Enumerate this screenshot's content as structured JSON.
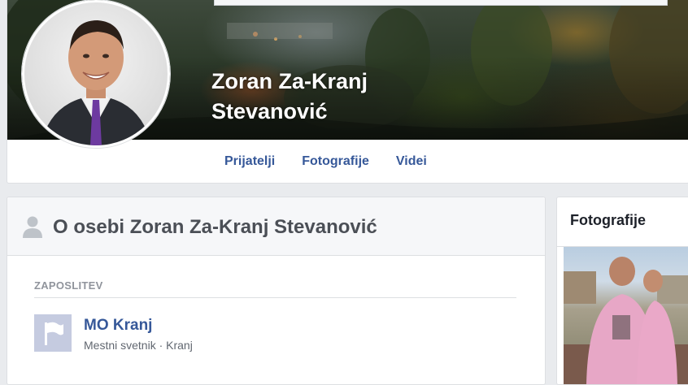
{
  "profile": {
    "name_line1": "Zoran Za-Kranj",
    "name_line2": "Stevanović"
  },
  "tabs": [
    {
      "label": "Prijatelji"
    },
    {
      "label": "Fotografije"
    },
    {
      "label": "Videi"
    }
  ],
  "about": {
    "title": "O osebi Zoran Za-Kranj Stevanović",
    "section_label": "ZAPOSLITEV",
    "job": {
      "title": "MO Kranj",
      "subtitle": "Mestni svetnik · Kranj"
    }
  },
  "photos": {
    "title": "Fotografije"
  },
  "colors": {
    "link": "#365899",
    "page_bg": "#e9ebee",
    "heading": "#4b4f56",
    "muted": "#90949c"
  },
  "icons": {
    "about": "person-icon",
    "job": "flag-icon"
  }
}
